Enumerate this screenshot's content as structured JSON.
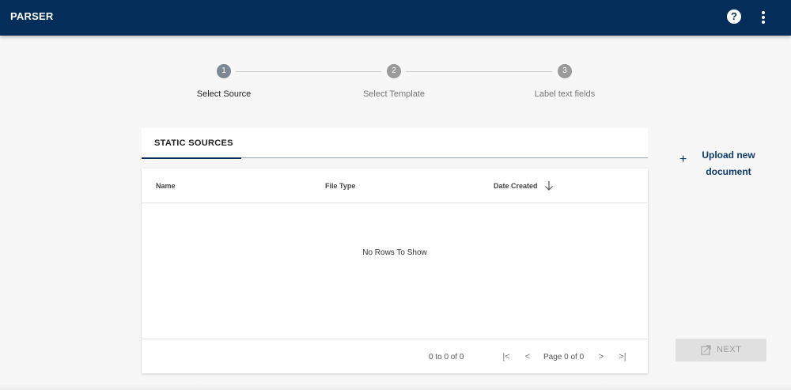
{
  "app": {
    "title": "PARSER"
  },
  "header": {
    "help_icon": "help-circle-icon",
    "menu_icon": "more-vert-icon",
    "help_glyph": "?"
  },
  "stepper": {
    "steps": [
      {
        "number": "1",
        "label": "Select Source",
        "active": true
      },
      {
        "number": "2",
        "label": "Select Template",
        "active": false
      },
      {
        "number": "3",
        "label": "Label text fields",
        "active": false
      }
    ],
    "colors": {
      "active": "#7d8896",
      "inactive": "#9a9a9a"
    }
  },
  "tabs": [
    {
      "label": "STATIC SOURCES",
      "selected": true
    }
  ],
  "grid": {
    "columns": [
      "Name",
      "File Type",
      "Date Created"
    ],
    "sorted_column": "Date Created",
    "sort_direction": "descending",
    "empty_message": "No Rows To Show",
    "footer": {
      "count": "0 to 0 of 0",
      "page": "Page 0 of 0"
    },
    "pager_glyphs": {
      "first": "|<",
      "prev": "<",
      "next": ">",
      "last": ">|"
    }
  },
  "upload": {
    "label": "Upload new document",
    "icon": "plus-icon",
    "plus": "+"
  },
  "next_button": {
    "label": "NEXT",
    "icon": "open-in-new-icon",
    "disabled": true
  },
  "colors": {
    "appbar": "#042d5a",
    "accent": "#042d5a",
    "background": "#f7f7f7"
  }
}
